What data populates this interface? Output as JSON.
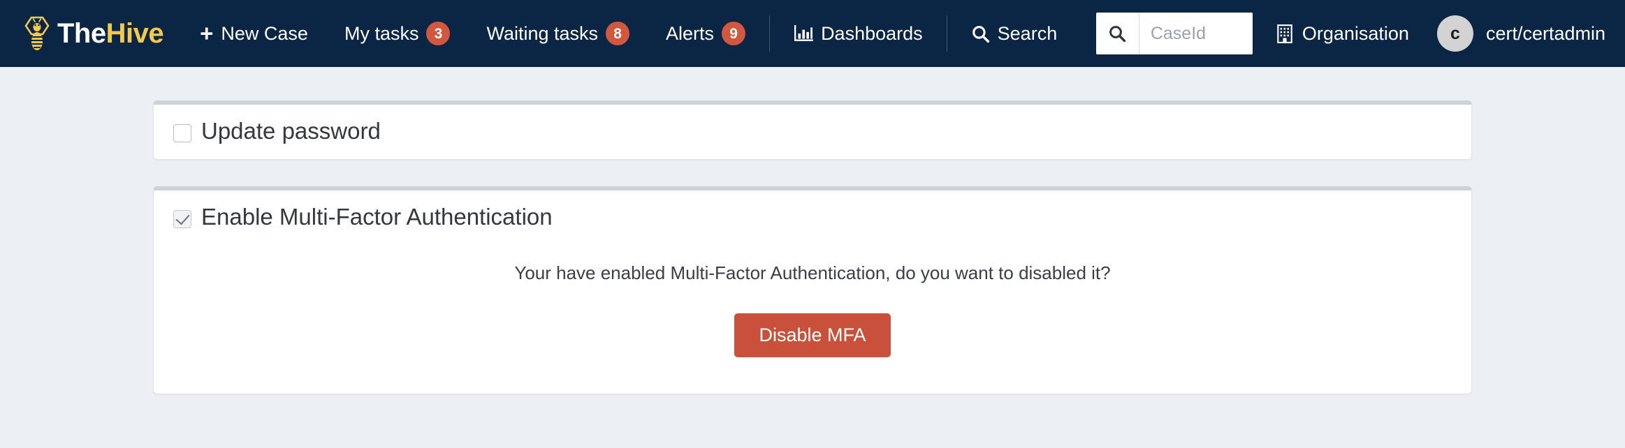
{
  "navbar": {
    "brand": {
      "the": "The",
      "hive": "Hive",
      "logo_icon": "bee-hexagon-logo"
    },
    "items": [
      {
        "id": "new-case",
        "label": "New Case",
        "icon": "plus-icon",
        "badge": null
      },
      {
        "id": "my-tasks",
        "label": "My tasks",
        "icon": null,
        "badge": "3"
      },
      {
        "id": "waiting-tasks",
        "label": "Waiting tasks",
        "icon": null,
        "badge": "8"
      },
      {
        "id": "alerts",
        "label": "Alerts",
        "icon": null,
        "badge": "9"
      },
      {
        "id": "dashboards",
        "label": "Dashboards",
        "icon": "bar-chart-icon",
        "badge": null
      },
      {
        "id": "search",
        "label": "Search",
        "icon": "search-icon",
        "badge": null
      }
    ],
    "search": {
      "placeholder": "CaseId",
      "value": "",
      "button_icon": "search-icon"
    },
    "organisation": {
      "label": "Organisation",
      "icon": "building-icon"
    },
    "user": {
      "avatar_initial": "c",
      "label": "cert/certadmin"
    }
  },
  "main": {
    "update_password_card": {
      "title": "Update password",
      "checked": false
    },
    "mfa_card": {
      "title": "Enable Multi-Factor Authentication",
      "checked": true,
      "message": "Your have enabled Multi-Factor Authentication, do you want to disabled it?",
      "button_label": "Disable MFA"
    }
  },
  "colors": {
    "navbar_bg": "#0b2545",
    "brand_accent": "#f2c94c",
    "badge_bg": "#d1573f",
    "danger_button": "#c9513c",
    "page_bg": "#eceff4"
  }
}
